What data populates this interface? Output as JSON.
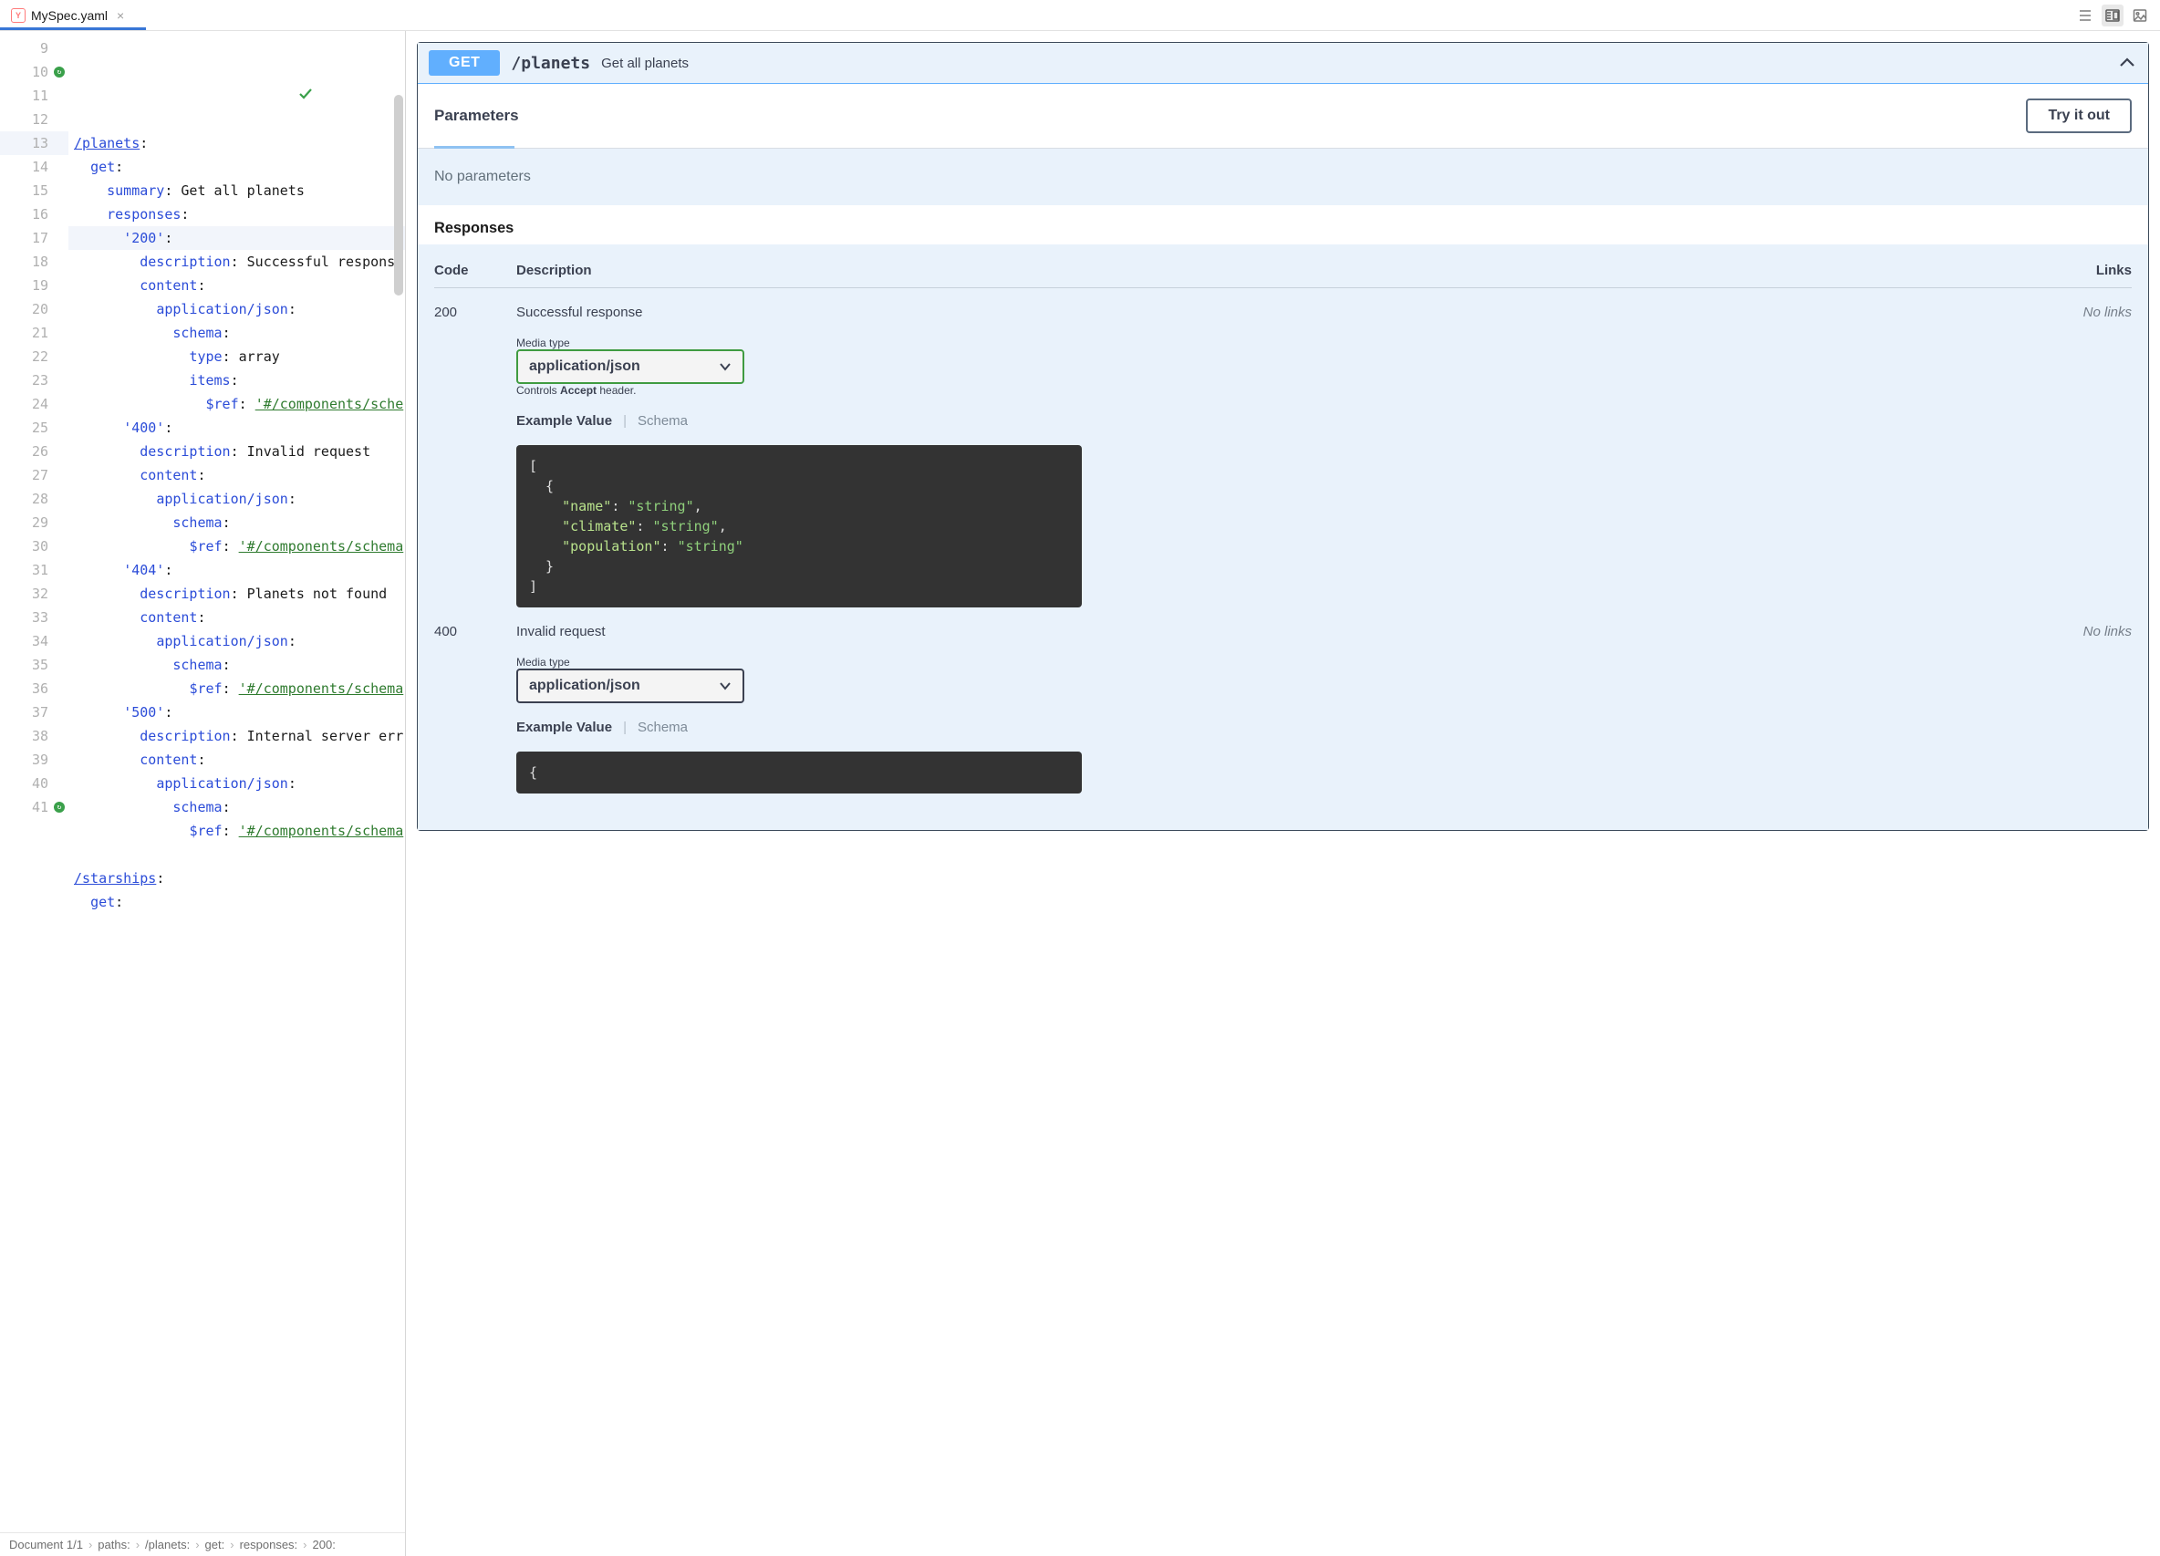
{
  "tab": {
    "filename": "MySpec.yaml"
  },
  "editor": {
    "lines": [
      {
        "n": 9,
        "hi": false,
        "g": false,
        "html": "<span class='kw und'>/planets</span><span class='pl'>:</span>"
      },
      {
        "n": 10,
        "hi": false,
        "g": true,
        "html": "  <span class='kw'>get</span><span class='pl'>:</span>"
      },
      {
        "n": 11,
        "hi": false,
        "g": false,
        "html": "    <span class='kw'>summary</span><span class='pl'>: Get all planets</span>"
      },
      {
        "n": 12,
        "hi": false,
        "g": false,
        "html": "    <span class='kw'>responses</span><span class='pl'>:</span>"
      },
      {
        "n": 13,
        "hi": true,
        "g": false,
        "html": "      <span class='kw'>'200'</span><span class='pl'>:</span>"
      },
      {
        "n": 14,
        "hi": false,
        "g": false,
        "html": "        <span class='kw'>description</span><span class='pl'>: Successful response</span>"
      },
      {
        "n": 15,
        "hi": false,
        "g": false,
        "html": "        <span class='kw'>content</span><span class='pl'>:</span>"
      },
      {
        "n": 16,
        "hi": false,
        "g": false,
        "html": "          <span class='kw'>application/json</span><span class='pl'>:</span>"
      },
      {
        "n": 17,
        "hi": false,
        "g": false,
        "html": "            <span class='kw'>schema</span><span class='pl'>:</span>"
      },
      {
        "n": 18,
        "hi": false,
        "g": false,
        "html": "              <span class='kw'>type</span><span class='pl'>: array</span>"
      },
      {
        "n": 19,
        "hi": false,
        "g": false,
        "html": "              <span class='kw'>items</span><span class='pl'>:</span>"
      },
      {
        "n": 20,
        "hi": false,
        "g": false,
        "html": "                <span class='kw'>$ref</span><span class='pl'>: </span><span class='str und'>'#/components/sche</span>"
      },
      {
        "n": 21,
        "hi": false,
        "g": false,
        "html": "      <span class='kw'>'400'</span><span class='pl'>:</span>"
      },
      {
        "n": 22,
        "hi": false,
        "g": false,
        "html": "        <span class='kw'>description</span><span class='pl'>: Invalid request</span>"
      },
      {
        "n": 23,
        "hi": false,
        "g": false,
        "html": "        <span class='kw'>content</span><span class='pl'>:</span>"
      },
      {
        "n": 24,
        "hi": false,
        "g": false,
        "html": "          <span class='kw'>application/json</span><span class='pl'>:</span>"
      },
      {
        "n": 25,
        "hi": false,
        "g": false,
        "html": "            <span class='kw'>schema</span><span class='pl'>:</span>"
      },
      {
        "n": 26,
        "hi": false,
        "g": false,
        "html": "              <span class='kw'>$ref</span><span class='pl'>: </span><span class='str und'>'#/components/schema</span>"
      },
      {
        "n": 27,
        "hi": false,
        "g": false,
        "html": "      <span class='kw'>'404'</span><span class='pl'>:</span>"
      },
      {
        "n": 28,
        "hi": false,
        "g": false,
        "html": "        <span class='kw'>description</span><span class='pl'>: Planets not found</span>"
      },
      {
        "n": 29,
        "hi": false,
        "g": false,
        "html": "        <span class='kw'>content</span><span class='pl'>:</span>"
      },
      {
        "n": 30,
        "hi": false,
        "g": false,
        "html": "          <span class='kw'>application/json</span><span class='pl'>:</span>"
      },
      {
        "n": 31,
        "hi": false,
        "g": false,
        "html": "            <span class='kw'>schema</span><span class='pl'>:</span>"
      },
      {
        "n": 32,
        "hi": false,
        "g": false,
        "html": "              <span class='kw'>$ref</span><span class='pl'>: </span><span class='str und'>'#/components/schema</span>"
      },
      {
        "n": 33,
        "hi": false,
        "g": false,
        "html": "      <span class='kw'>'500'</span><span class='pl'>:</span>"
      },
      {
        "n": 34,
        "hi": false,
        "g": false,
        "html": "        <span class='kw'>description</span><span class='pl'>: Internal server err</span>"
      },
      {
        "n": 35,
        "hi": false,
        "g": false,
        "html": "        <span class='kw'>content</span><span class='pl'>:</span>"
      },
      {
        "n": 36,
        "hi": false,
        "g": false,
        "html": "          <span class='kw'>application/json</span><span class='pl'>:</span>"
      },
      {
        "n": 37,
        "hi": false,
        "g": false,
        "html": "            <span class='kw'>schema</span><span class='pl'>:</span>"
      },
      {
        "n": 38,
        "hi": false,
        "g": false,
        "html": "              <span class='kw'>$ref</span><span class='pl'>: </span><span class='str und'>'#/components/schema</span>"
      },
      {
        "n": 39,
        "hi": false,
        "g": false,
        "html": ""
      },
      {
        "n": 40,
        "hi": false,
        "g": false,
        "html": "<span class='kw und'>/starships</span><span class='pl'>:</span>"
      },
      {
        "n": 41,
        "hi": false,
        "g": true,
        "html": "  <span class='kw'>get</span><span class='pl'>:</span>"
      }
    ]
  },
  "breadcrumb": {
    "doc": "Document 1/1",
    "items": [
      "paths:",
      "/planets:",
      "get:",
      "responses:",
      "200:"
    ]
  },
  "op": {
    "method": "GET",
    "path": "/planets",
    "summary": "Get all planets",
    "parameters_title": "Parameters",
    "tryout": "Try it out",
    "no_params": "No parameters",
    "responses_title": "Responses",
    "th_code": "Code",
    "th_desc": "Description",
    "th_links": "Links",
    "media_label": "Media type",
    "media_value": "application/json",
    "accepts_pre": "Controls ",
    "accepts_b": "Accept",
    "accepts_post": " header.",
    "example_label": "Example Value",
    "schema_label": "Schema",
    "no_links": "No links",
    "r200": {
      "code": "200",
      "desc": "Successful response",
      "example": "[\n  {\n    \"name\": \"string\",\n    \"climate\": \"string\",\n    \"population\": \"string\"\n  }\n]"
    },
    "r400": {
      "code": "400",
      "desc": "Invalid request",
      "example": "{"
    }
  }
}
